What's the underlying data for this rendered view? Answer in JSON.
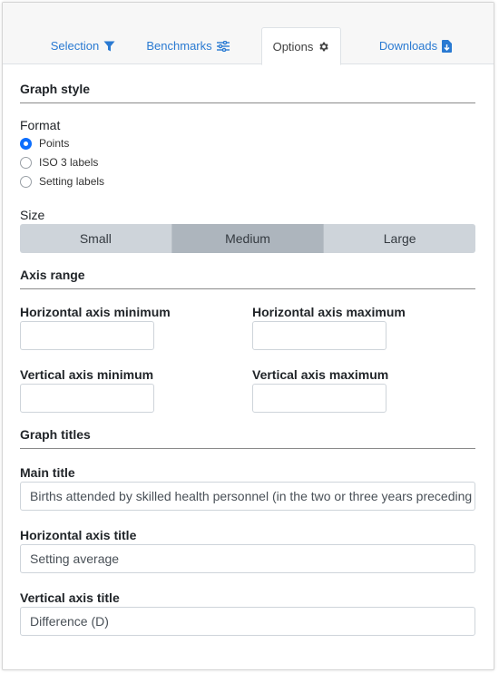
{
  "tabs": [
    {
      "label": "Selection",
      "icon": "filter-icon"
    },
    {
      "label": "Benchmarks",
      "icon": "sliders-icon"
    },
    {
      "label": "Options",
      "icon": "gear-icon"
    },
    {
      "label": "Downloads",
      "icon": "file-download-icon"
    }
  ],
  "active_tab": "Options",
  "graph_style": {
    "title": "Graph style",
    "format_label": "Format",
    "format_options": [
      "Points",
      "ISO 3 labels",
      "Setting labels"
    ],
    "format_selected": "Points",
    "size_label": "Size",
    "size_options": [
      "Small",
      "Medium",
      "Large"
    ],
    "size_selected": "Medium"
  },
  "axis_range": {
    "title": "Axis range",
    "h_min_label": "Horizontal axis minimum",
    "h_max_label": "Horizontal axis maximum",
    "v_min_label": "Vertical axis minimum",
    "v_max_label": "Vertical axis maximum",
    "h_min_value": "",
    "h_max_value": "",
    "v_min_value": "",
    "v_max_value": ""
  },
  "graph_titles": {
    "title": "Graph titles",
    "main_title_label": "Main title",
    "main_title_value": "Births attended by skilled health personnel (in the two or three years preceding",
    "h_axis_title_label": "Horizontal axis title",
    "h_axis_title_value": "Setting average",
    "v_axis_title_label": "Vertical axis title",
    "v_axis_title_value": "Difference (D)"
  },
  "colors": {
    "link": "#2a7ad2",
    "radio_checked": "#0d6efd",
    "segment_bg": "#ced4da",
    "segment_active": "#adb5bd"
  }
}
